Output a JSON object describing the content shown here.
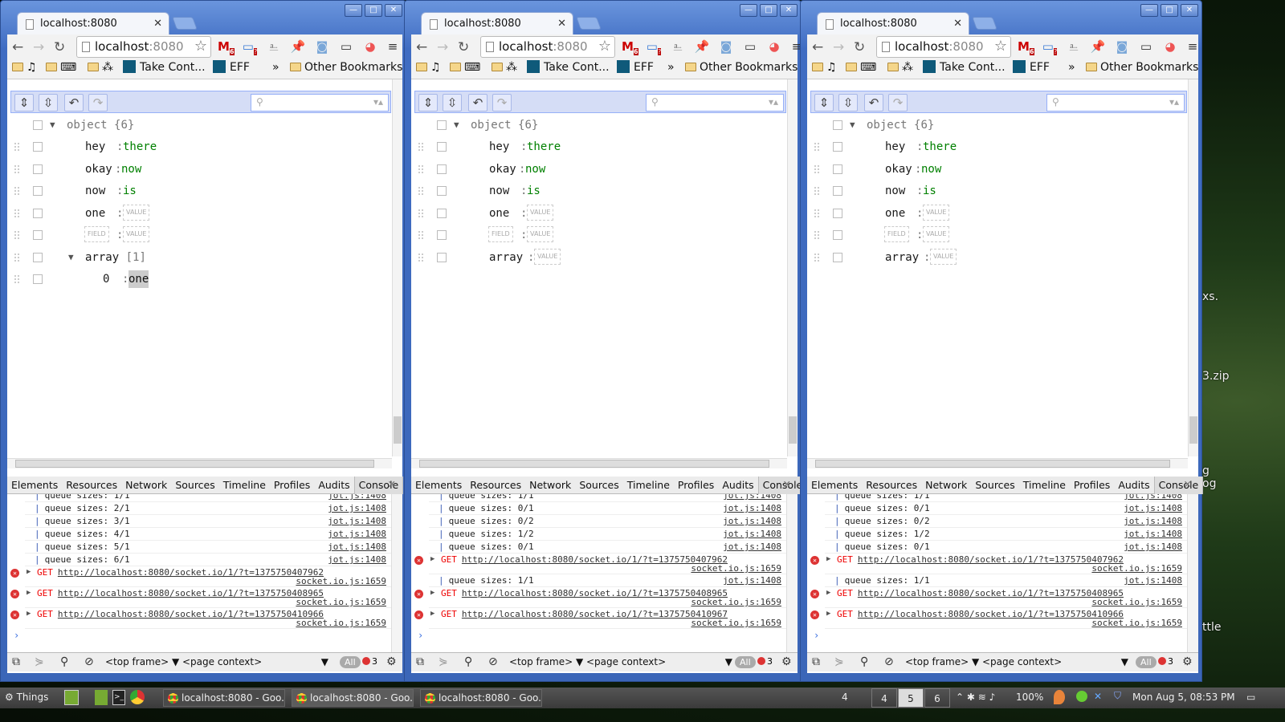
{
  "desktop": {
    "labels": [
      "xs.",
      "3.zip",
      "g",
      "og",
      "ttle"
    ]
  },
  "browser": {
    "tab_title": "localhost:8080",
    "url_host": "localhost",
    "url_port": ":8080",
    "bookmarks": {
      "take_control": "Take Cont...",
      "eff": "EFF",
      "overflow": "»",
      "other": "Other Bookmarks",
      "music_icon": "♫",
      "keyboard_icon": "⌨",
      "sparkle_icon": "⁂"
    },
    "extension_badges": {
      "gmail": "6",
      "screen": "?"
    },
    "devtools_tabs": [
      "Elements",
      "Resources",
      "Network",
      "Sources",
      "Timeline",
      "Profiles",
      "Audits",
      "Console"
    ],
    "active_devtools_tab": "Console",
    "frame_select": "<top frame>",
    "context_select": "<page context>",
    "filter_all": "All",
    "error_count": "3",
    "placeholder_value": "VALUE",
    "placeholder_field": "FIELD"
  },
  "windows": [
    {
      "tree": {
        "root": {
          "label": "object",
          "count": "{6}"
        },
        "rows": [
          {
            "key": "hey",
            "value": "there"
          },
          {
            "key": "okay",
            "value": "now"
          },
          {
            "key": "now",
            "value": "is"
          },
          {
            "key": "one",
            "value": null
          },
          {
            "key": null,
            "value": null
          },
          {
            "key": "array",
            "count": "[1]",
            "expanded": true
          },
          {
            "key": "0",
            "value": "one",
            "indent": true,
            "highlight": true
          }
        ]
      },
      "console": [
        {
          "type": "log",
          "text": "queue sizes: 1/1",
          "src": "jot.js:1408"
        },
        {
          "type": "log",
          "text": "queue sizes: 2/1",
          "src": "jot.js:1408"
        },
        {
          "type": "log",
          "text": "queue sizes: 3/1",
          "src": "jot.js:1408"
        },
        {
          "type": "log",
          "text": "queue sizes: 4/1",
          "src": "jot.js:1408"
        },
        {
          "type": "log",
          "text": "queue sizes: 5/1",
          "src": "jot.js:1408"
        },
        {
          "type": "log",
          "text": "queue sizes: 6/1",
          "src": "jot.js:1408"
        },
        {
          "type": "error",
          "method": "GET",
          "url": "http://localhost:8080/socket.io/1/?t=1375750407962",
          "src": "socket.io.js:1659"
        },
        {
          "type": "error",
          "method": "GET",
          "url": "http://localhost:8080/socket.io/1/?t=1375750408965",
          "src": "socket.io.js:1659"
        },
        {
          "type": "error",
          "method": "GET",
          "url": "http://localhost:8080/socket.io/1/?t=1375750410966",
          "src": "socket.io.js:1659"
        }
      ]
    },
    {
      "tree": {
        "root": {
          "label": "object",
          "count": "{6}"
        },
        "rows": [
          {
            "key": "hey",
            "value": "there"
          },
          {
            "key": "okay",
            "value": "now"
          },
          {
            "key": "now",
            "value": "is"
          },
          {
            "key": "one",
            "value": null
          },
          {
            "key": null,
            "value": null
          },
          {
            "key": "array",
            "value": null
          }
        ]
      },
      "console": [
        {
          "type": "log",
          "text": "queue sizes: 1/1",
          "src": "jot.js:1408"
        },
        {
          "type": "log",
          "text": "queue sizes: 0/1",
          "src": "jot.js:1408"
        },
        {
          "type": "log",
          "text": "queue sizes: 0/2",
          "src": "jot.js:1408"
        },
        {
          "type": "log",
          "text": "queue sizes: 1/2",
          "src": "jot.js:1408"
        },
        {
          "type": "log",
          "text": "queue sizes: 0/1",
          "src": "jot.js:1408"
        },
        {
          "type": "error",
          "method": "GET",
          "url": "http://localhost:8080/socket.io/1/?t=1375750407962",
          "src": "socket.io.js:1659"
        },
        {
          "type": "log",
          "text": "queue sizes: 1/1",
          "src": "jot.js:1408"
        },
        {
          "type": "error",
          "method": "GET",
          "url": "http://localhost:8080/socket.io/1/?t=1375750408965",
          "src": "socket.io.js:1659"
        },
        {
          "type": "error",
          "method": "GET",
          "url": "http://localhost:8080/socket.io/1/?t=1375750410967",
          "src": "socket.io.js:1659"
        }
      ]
    },
    {
      "tree": {
        "root": {
          "label": "object",
          "count": "{6}"
        },
        "rows": [
          {
            "key": "hey",
            "value": "there"
          },
          {
            "key": "okay",
            "value": "now"
          },
          {
            "key": "now",
            "value": "is"
          },
          {
            "key": "one",
            "value": null
          },
          {
            "key": null,
            "value": null
          },
          {
            "key": "array",
            "value": null
          }
        ]
      },
      "console": [
        {
          "type": "log",
          "text": "queue sizes: 1/1",
          "src": "jot.js:1408"
        },
        {
          "type": "log",
          "text": "queue sizes: 0/1",
          "src": "jot.js:1408"
        },
        {
          "type": "log",
          "text": "queue sizes: 0/2",
          "src": "jot.js:1408"
        },
        {
          "type": "log",
          "text": "queue sizes: 1/2",
          "src": "jot.js:1408"
        },
        {
          "type": "log",
          "text": "queue sizes: 0/1",
          "src": "jot.js:1408"
        },
        {
          "type": "error",
          "method": "GET",
          "url": "http://localhost:8080/socket.io/1/?t=1375750407962",
          "src": "socket.io.js:1659"
        },
        {
          "type": "log",
          "text": "queue sizes: 1/1",
          "src": "jot.js:1408"
        },
        {
          "type": "error",
          "method": "GET",
          "url": "http://localhost:8080/socket.io/1/?t=1375750408965",
          "src": "socket.io.js:1659"
        },
        {
          "type": "error",
          "method": "GET",
          "url": "http://localhost:8080/socket.io/1/?t=1375750410966",
          "src": "socket.io.js:1659"
        }
      ]
    }
  ],
  "taskbar": {
    "menu_label": "Things",
    "tasks": [
      "localhost:8080 - Goo...",
      "localhost:8080 - Goo...",
      "localhost:8080 - Goo..."
    ],
    "active_task": 1,
    "notification_count": "4",
    "workspaces": [
      "4",
      "5",
      "6"
    ],
    "active_workspace": "5",
    "battery": "100%",
    "clock": "Mon Aug  5, 08:53 PM"
  }
}
